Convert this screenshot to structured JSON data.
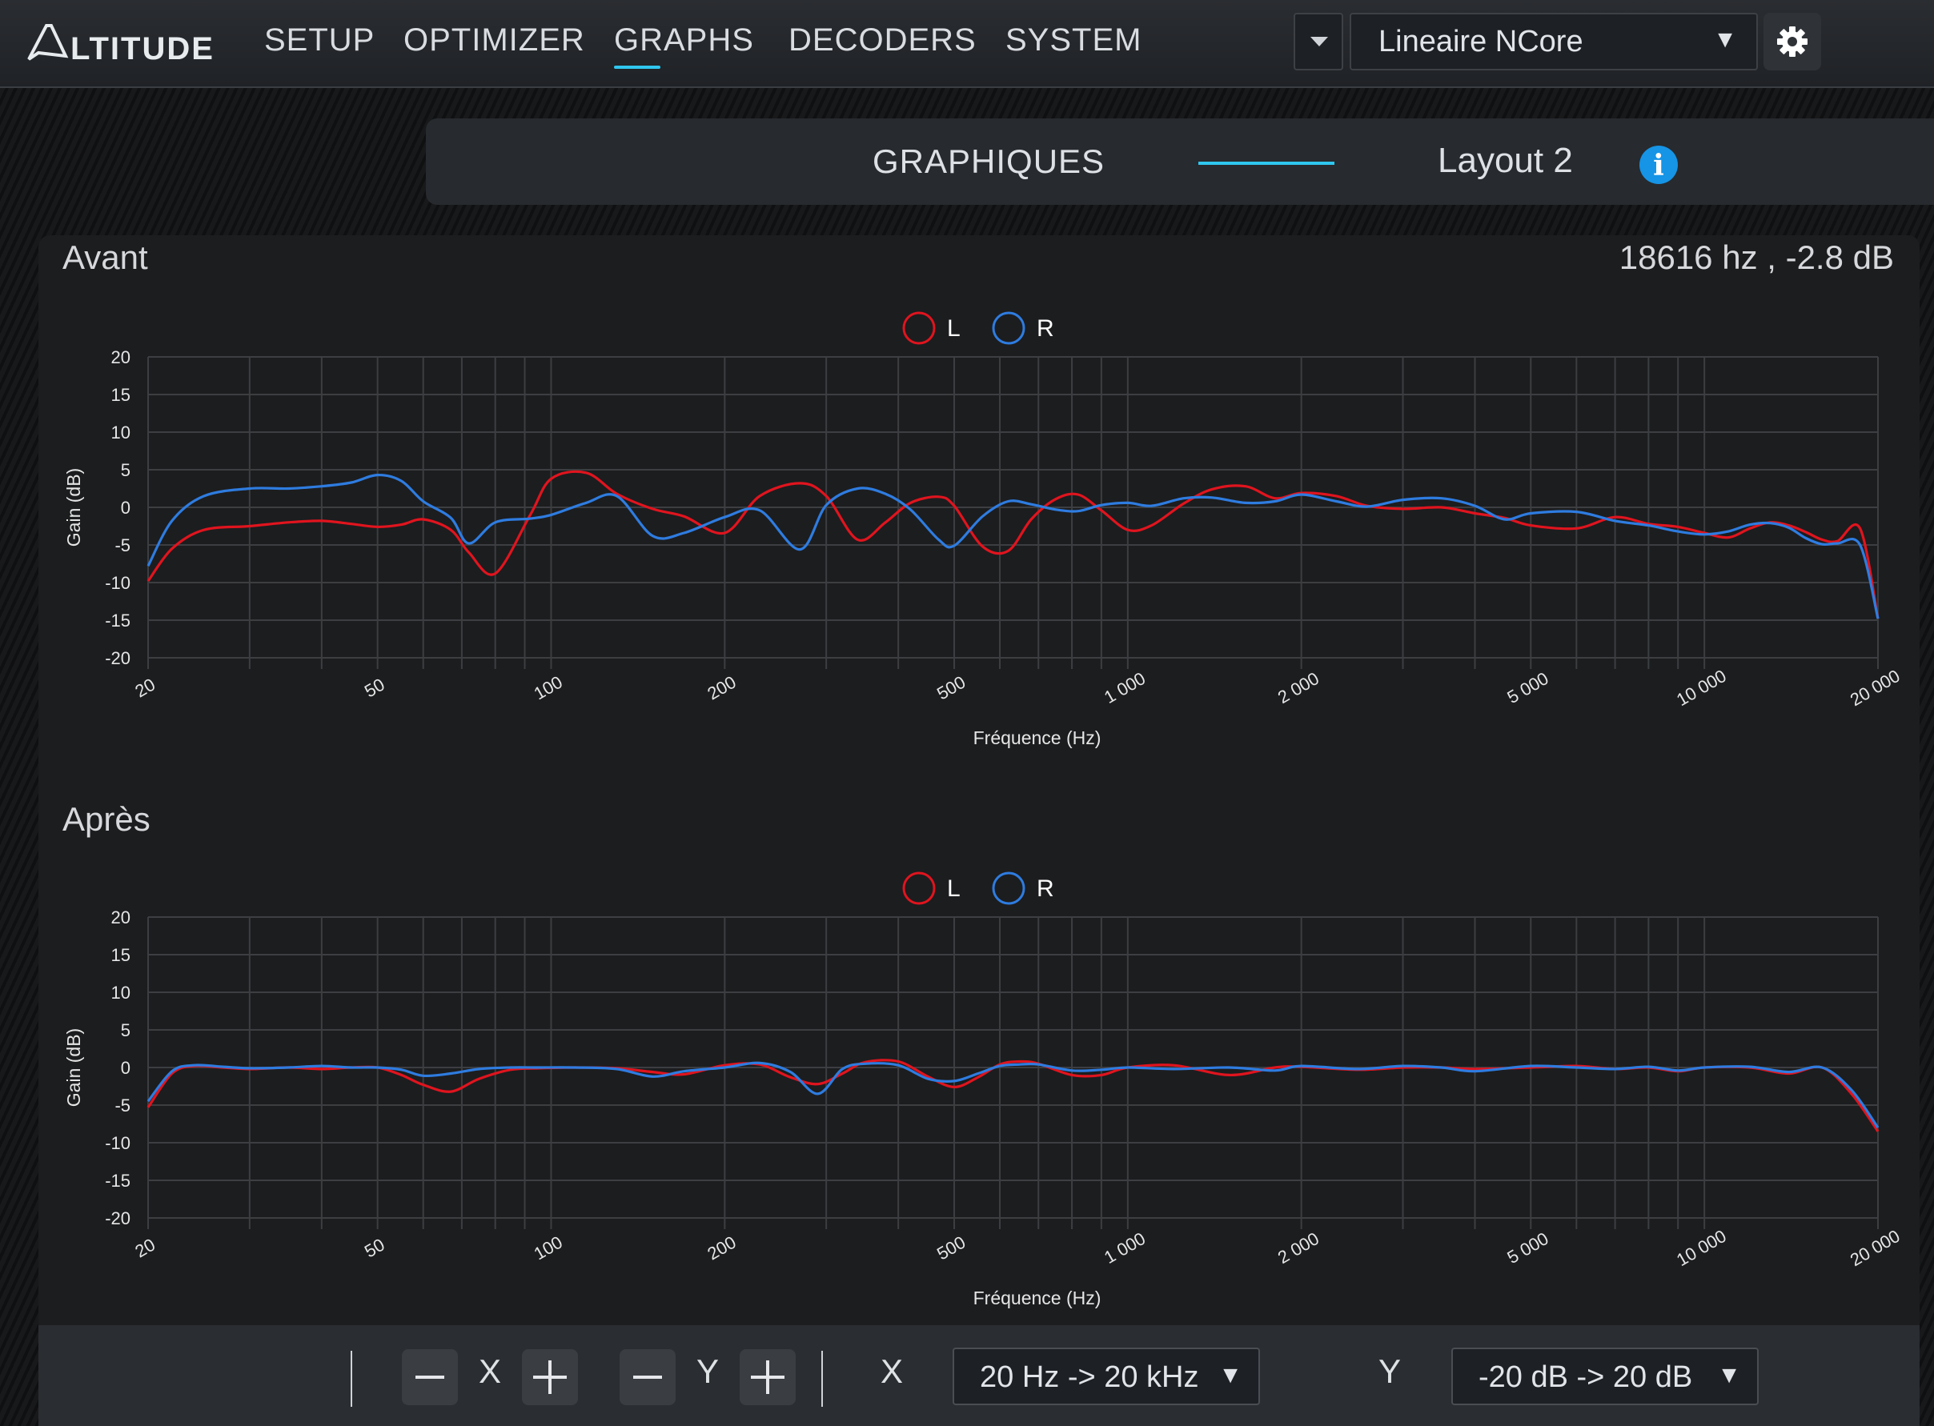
{
  "header": {
    "logo_text": "ALTITUDE",
    "nav": [
      "SETUP",
      "OPTIMIZER",
      "GRAPHS",
      "DECODERS",
      "SYSTEM"
    ],
    "active_nav": "GRAPHS",
    "device_select": "Lineaire NCore",
    "select_arrow": "▼"
  },
  "subheader": {
    "title": "GRAPHIQUES",
    "layout": "Layout 2",
    "info_icon": "i"
  },
  "colors": {
    "accent": "#2fc7ef",
    "series_L": "#e0141e",
    "series_R": "#2e7ce0",
    "info": "#1694e6"
  },
  "readout": "18616 hz , -2.8 dB",
  "chart_data": [
    {
      "type": "line",
      "title": "Avant",
      "xscale": "log",
      "xlabel": "Fréquence (Hz)",
      "ylabel": "Gain (dB)",
      "xlim": [
        20,
        20000
      ],
      "ylim": [
        -20,
        20
      ],
      "xticks": [
        "20",
        "50",
        "100",
        "200",
        "500",
        "1 000",
        "2 000",
        "5 000",
        "10 000",
        "20 000"
      ],
      "yticks": [
        "20",
        "15",
        "10",
        "5",
        "0",
        "-5",
        "-10",
        "-15",
        "-20"
      ],
      "legend": [
        "L",
        "R"
      ],
      "series": [
        {
          "name": "L",
          "x": [
            20,
            22,
            25,
            30,
            35,
            40,
            45,
            50,
            55,
            60,
            67,
            72,
            80,
            92,
            100,
            115,
            130,
            150,
            170,
            200,
            230,
            270,
            300,
            340,
            380,
            420,
            470,
            500,
            560,
            620,
            680,
            750,
            820,
            900,
            1000,
            1100,
            1250,
            1400,
            1600,
            1800,
            2000,
            2300,
            2600,
            3000,
            3500,
            4000,
            4500,
            5000,
            6000,
            7000,
            8000,
            9000,
            10000,
            11000,
            12000,
            13000,
            14000,
            15000,
            16000,
            17000,
            18616,
            20000
          ],
          "y": [
            -9.8,
            -5.5,
            -3,
            -2.5,
            -2,
            -1.8,
            -2.2,
            -2.6,
            -2.3,
            -1.6,
            -3,
            -6,
            -8.8,
            -1,
            3.8,
            4.6,
            1.8,
            -0.2,
            -1.2,
            -3.4,
            1.5,
            3.2,
            1.5,
            -4.3,
            -2,
            0.6,
            1.4,
            0.2,
            -5.2,
            -5.8,
            -1.6,
            1.1,
            1.7,
            -0.4,
            -3,
            -2.4,
            0.5,
            2.4,
            2.8,
            1.2,
            1.9,
            1.5,
            0.2,
            -0.2,
            0,
            -0.8,
            -1.4,
            -2.4,
            -2.8,
            -1.3,
            -2.2,
            -2.6,
            -3.4,
            -4,
            -2.8,
            -2,
            -2.4,
            -3.3,
            -4.3,
            -4.5,
            -2.8,
            -14.8
          ]
        },
        {
          "name": "R",
          "x": [
            20,
            22,
            25,
            30,
            35,
            40,
            45,
            50,
            55,
            60,
            67,
            72,
            80,
            92,
            100,
            115,
            130,
            150,
            170,
            200,
            230,
            270,
            300,
            340,
            380,
            420,
            470,
            500,
            560,
            620,
            680,
            750,
            820,
            900,
            1000,
            1100,
            1250,
            1400,
            1600,
            1800,
            2000,
            2300,
            2600,
            3000,
            3500,
            4000,
            4500,
            5000,
            6000,
            7000,
            8000,
            9000,
            10000,
            11000,
            12000,
            13000,
            14000,
            15000,
            16000,
            17000,
            18616,
            20000
          ],
          "y": [
            -7.8,
            -1.8,
            1.5,
            2.5,
            2.5,
            2.8,
            3.3,
            4.3,
            3.5,
            0.8,
            -1.4,
            -4.8,
            -2,
            -1.5,
            -1,
            0.6,
            1.5,
            -3.8,
            -3.4,
            -1.3,
            -0.4,
            -5.6,
            0.3,
            2.5,
            1.8,
            -0.3,
            -4.3,
            -5.1,
            -1.2,
            0.8,
            0.4,
            -0.3,
            -0.5,
            0.3,
            0.6,
            0.2,
            1.2,
            1.3,
            0.6,
            0.8,
            1.7,
            0.8,
            0.1,
            1,
            1.2,
            0.2,
            -1.6,
            -0.8,
            -0.6,
            -1.8,
            -2.4,
            -3.2,
            -3.6,
            -3.2,
            -2.3,
            -2.1,
            -2.7,
            -4.1,
            -4.9,
            -4.8,
            -5,
            -14.8
          ]
        }
      ]
    },
    {
      "type": "line",
      "title": "Après",
      "xscale": "log",
      "xlabel": "Fréquence (Hz)",
      "ylabel": "Gain (dB)",
      "xlim": [
        20,
        20000
      ],
      "ylim": [
        -20,
        20
      ],
      "xticks": [
        "20",
        "50",
        "100",
        "200",
        "500",
        "1 000",
        "2 000",
        "5 000",
        "10 000",
        "20 000"
      ],
      "yticks": [
        "20",
        "15",
        "10",
        "5",
        "0",
        "-5",
        "-10",
        "-15",
        "-20"
      ],
      "legend": [
        "L",
        "R"
      ],
      "series": [
        {
          "name": "L",
          "x": [
            20,
            22,
            24,
            27,
            30,
            35,
            40,
            45,
            50,
            55,
            60,
            67,
            75,
            85,
            95,
            110,
            130,
            150,
            170,
            200,
            230,
            260,
            290,
            320,
            350,
            400,
            450,
            500,
            550,
            600,
            650,
            700,
            800,
            900,
            1000,
            1200,
            1500,
            1800,
            2000,
            2500,
            3000,
            3500,
            4000,
            5000,
            6000,
            7000,
            8000,
            9000,
            10000,
            12000,
            14000,
            16000,
            18000,
            20000
          ],
          "y": [
            -5.3,
            -0.8,
            0.2,
            0,
            -0.2,
            0,
            -0.2,
            0,
            0,
            -1,
            -2.3,
            -3.2,
            -1.5,
            -0.3,
            -0.1,
            0,
            -0.1,
            -0.6,
            -0.9,
            0.3,
            0.4,
            -1.3,
            -2.2,
            -0.8,
            0.7,
            0.8,
            -1.2,
            -2.6,
            -1.3,
            0.4,
            0.8,
            0.5,
            -1,
            -1,
            0,
            0.3,
            -1,
            0,
            0.1,
            -0.3,
            0,
            0,
            -0.2,
            0,
            0.2,
            -0.2,
            0,
            -0.5,
            0,
            0,
            -0.8,
            0,
            -3.5,
            -8.5
          ]
        },
        {
          "name": "R",
          "x": [
            20,
            22,
            24,
            27,
            30,
            35,
            40,
            45,
            50,
            55,
            60,
            67,
            75,
            85,
            95,
            110,
            130,
            150,
            170,
            200,
            230,
            260,
            290,
            320,
            350,
            400,
            450,
            500,
            550,
            600,
            650,
            700,
            800,
            900,
            1000,
            1200,
            1500,
            1800,
            2000,
            2500,
            3000,
            3500,
            4000,
            5000,
            6000,
            7000,
            8000,
            9000,
            10000,
            12000,
            14000,
            16000,
            18000,
            20000
          ],
          "y": [
            -4.5,
            -0.5,
            0.3,
            0.1,
            -0.1,
            0,
            0.2,
            0,
            0,
            -0.3,
            -1.1,
            -0.8,
            -0.2,
            0,
            0,
            0,
            -0.2,
            -1.2,
            -0.5,
            0,
            0.6,
            -0.6,
            -3.5,
            -0.2,
            0.5,
            0.3,
            -1.5,
            -1.8,
            -0.8,
            0.2,
            0.4,
            0.4,
            -0.4,
            -0.3,
            0,
            -0.2,
            0,
            -0.4,
            0.2,
            -0.2,
            0.2,
            0,
            -0.5,
            0.2,
            0,
            -0.2,
            0.1,
            -0.4,
            0,
            0.1,
            -0.6,
            0,
            -3,
            -8
          ]
        }
      ]
    }
  ],
  "toolbar": {
    "x_label": "X",
    "y_label": "Y",
    "x_range_label": "X",
    "y_range_label": "Y",
    "x_range": "20 Hz -> 20 kHz",
    "y_range": "-20 dB -> 20 dB",
    "select_arrow": "▼"
  }
}
